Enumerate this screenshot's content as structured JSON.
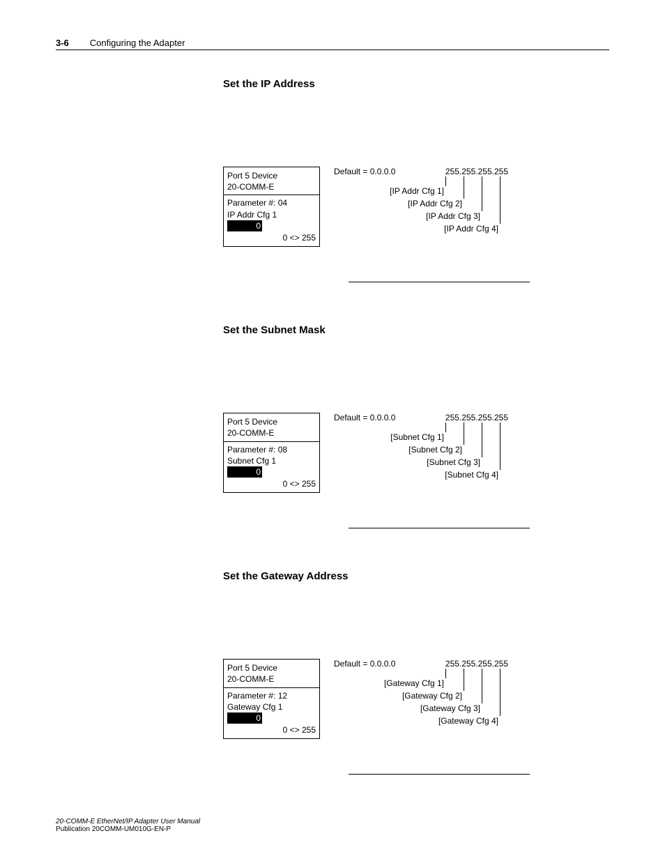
{
  "header": {
    "page_number": "3-6",
    "chapter": "Configuring the Adapter"
  },
  "sections": [
    {
      "heading": "Set the IP Address",
      "lcd": {
        "port": "Port 5 Device",
        "device": "20-COMM-E",
        "param": "Parameter #: 04",
        "name": "IP Addr Cfg 1",
        "value": "0",
        "range": "0 <> 255"
      },
      "diagram": {
        "default_label": "Default = 0.0.0.0",
        "ip_example": "255.255.255.255",
        "cfg_labels": [
          "[IP Addr Cfg 1]",
          "[IP Addr Cfg 2]",
          "[IP Addr Cfg 3]",
          "[IP Addr Cfg 4]"
        ]
      }
    },
    {
      "heading": "Set the Subnet Mask",
      "lcd": {
        "port": "Port 5 Device",
        "device": "20-COMM-E",
        "param": "Parameter #: 08",
        "name": "Subnet Cfg 1",
        "value": "0",
        "range": "0 <> 255"
      },
      "diagram": {
        "default_label": "Default = 0.0.0.0",
        "ip_example": "255.255.255.255",
        "cfg_labels": [
          "[Subnet Cfg 1]",
          "[Subnet Cfg 2]",
          "[Subnet Cfg 3]",
          "[Subnet Cfg 4]"
        ]
      }
    },
    {
      "heading": "Set the Gateway Address",
      "lcd": {
        "port": "Port 5 Device",
        "device": "20-COMM-E",
        "param": "Parameter #: 12",
        "name": "Gateway Cfg 1",
        "value": "0",
        "range": "0 <> 255"
      },
      "diagram": {
        "default_label": "Default = 0.0.0.0",
        "ip_example": "255.255.255.255",
        "cfg_labels": [
          "[Gateway Cfg 1]",
          "[Gateway Cfg 2]",
          "[Gateway Cfg 3]",
          "[Gateway Cfg 4]"
        ]
      }
    }
  ],
  "footer": {
    "title": "20-COMM-E EtherNet/IP Adapter User Manual",
    "publication": "Publication 20COMM-UM010G-EN-P"
  }
}
